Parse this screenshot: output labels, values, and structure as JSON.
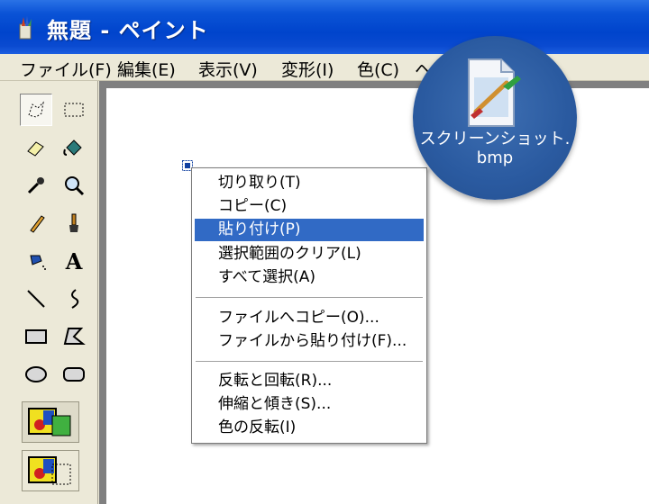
{
  "window": {
    "title": "無題 - ペイント"
  },
  "menubar": {
    "items": [
      "ファイル(F)",
      "編集(E)",
      "表示(V)",
      "変形(I)",
      "色(C)",
      "ヘ"
    ]
  },
  "toolbox": {
    "tools": [
      {
        "name": "free-select-icon",
        "selected": true
      },
      {
        "name": "rect-select-icon"
      },
      {
        "name": "eraser-icon"
      },
      {
        "name": "fill-icon"
      },
      {
        "name": "color-picker-icon"
      },
      {
        "name": "magnifier-icon"
      },
      {
        "name": "pencil-icon"
      },
      {
        "name": "brush-icon"
      },
      {
        "name": "airbrush-icon"
      },
      {
        "name": "text-icon",
        "label": "A"
      },
      {
        "name": "line-icon"
      },
      {
        "name": "curve-icon"
      },
      {
        "name": "rectangle-icon"
      },
      {
        "name": "polygon-icon"
      },
      {
        "name": "ellipse-icon"
      },
      {
        "name": "rounded-rect-icon"
      }
    ]
  },
  "context_menu": {
    "groups": [
      [
        "切り取り(T)",
        "コピー(C)",
        "貼り付け(P)",
        "選択範囲のクリア(L)",
        "すべて選択(A)"
      ],
      [
        "ファイルへコピー(O)...",
        "ファイルから貼り付け(F)..."
      ],
      [
        "反転と回転(R)...",
        "伸縮と傾き(S)...",
        "色の反転(I)"
      ]
    ],
    "highlighted": "貼り付け(P)"
  },
  "desktop_icon": {
    "label_line1": "スクリーンショット.",
    "label_line2": "bmp"
  },
  "colors": {
    "titlebar": "#0044cc",
    "chrome": "#ECE9D8",
    "highlight": "#316AC5",
    "badge": "#2a5aa0"
  }
}
